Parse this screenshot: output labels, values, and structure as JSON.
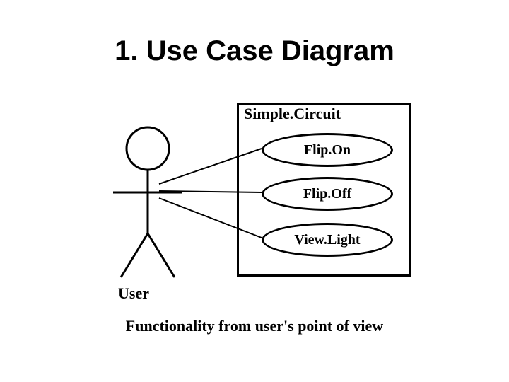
{
  "title": "1. Use Case Diagram",
  "diagram": {
    "system_name": "Simple.Circuit",
    "usecases": [
      "Flip.On",
      "Flip.Off",
      "View.Light"
    ],
    "actor_label": "User",
    "caption": "Functionality from user's point of view"
  }
}
